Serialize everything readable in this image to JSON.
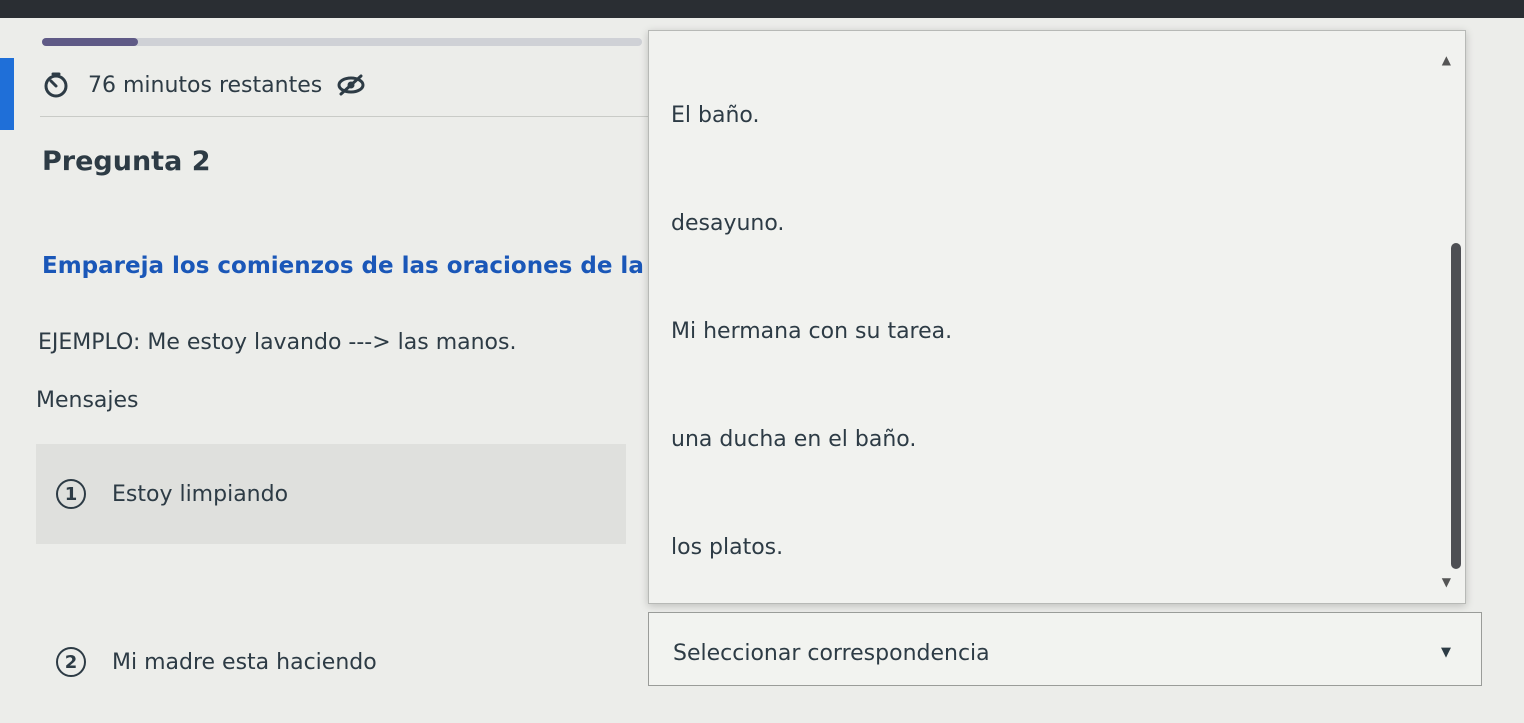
{
  "timer": {
    "text": "76 minutos restantes"
  },
  "progress": {
    "fraction": 0.16
  },
  "question": {
    "title": "Pregunta 2",
    "instructions": "Empareja los comienzos de las oraciones de la",
    "example": "EJEMPLO: Me estoy lavando ---> las manos.",
    "section_label": "Mensajes"
  },
  "items": [
    {
      "number": "1",
      "text": "Estoy limpiando"
    },
    {
      "number": "2",
      "text": "Mi madre esta haciendo"
    }
  ],
  "dropdown": {
    "options": [
      "El baño.",
      "desayuno.",
      "Mi hermana con su tarea.",
      "una ducha en el baño.",
      "los platos."
    ]
  },
  "select": {
    "placeholder": "Seleccionar correspondencia"
  },
  "colors": {
    "accent": "#1f6fd8",
    "instruction_text": "#1a57b8",
    "progress_fill": "#5f5a86"
  },
  "icons": {
    "timer": "timer-icon",
    "hide": "eye-slash-icon",
    "caret": "caret-down-icon"
  }
}
